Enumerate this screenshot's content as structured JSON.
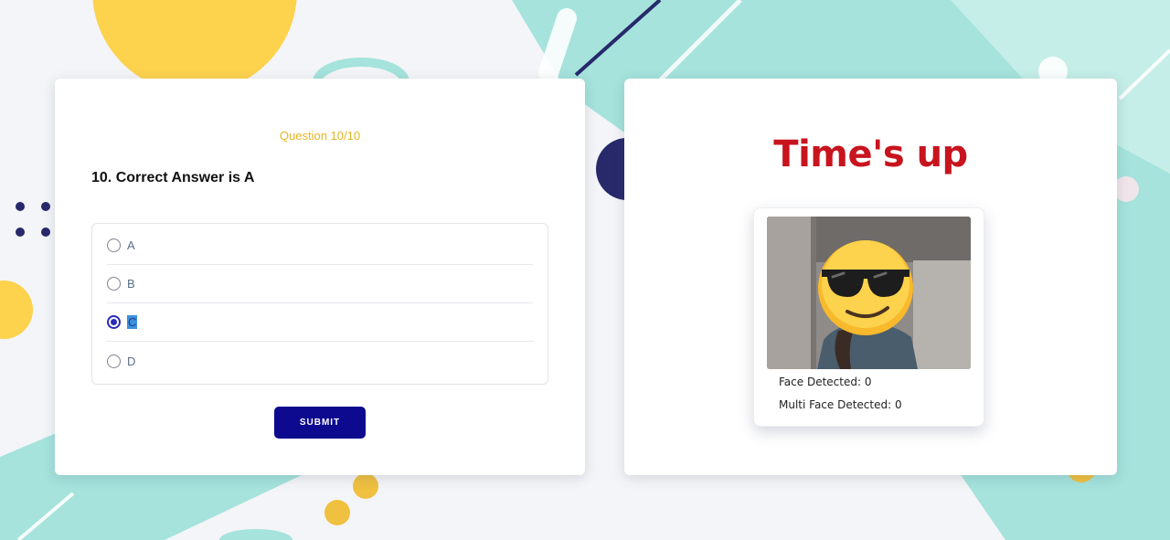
{
  "quiz": {
    "counter": "Question 10/10",
    "question": "10. Correct Answer is A",
    "options": [
      {
        "label": "A",
        "selected": false
      },
      {
        "label": "B",
        "selected": false
      },
      {
        "label": "C",
        "selected": true
      },
      {
        "label": "D",
        "selected": false
      }
    ],
    "submit_label": "SUBMIT"
  },
  "monitor": {
    "title": "Time's up",
    "face_detected_label": "Face Detected: 0",
    "multi_face_label": "Multi Face Detected: 0"
  },
  "colors": {
    "accent": "#0e0a8f",
    "counter": "#e6b422",
    "alert": "#c8141e",
    "background_teal": "#a5e3dc",
    "background_yellow": "#fdd24c"
  },
  "icons": {
    "face_cover": "sunglasses-emoji-icon"
  }
}
